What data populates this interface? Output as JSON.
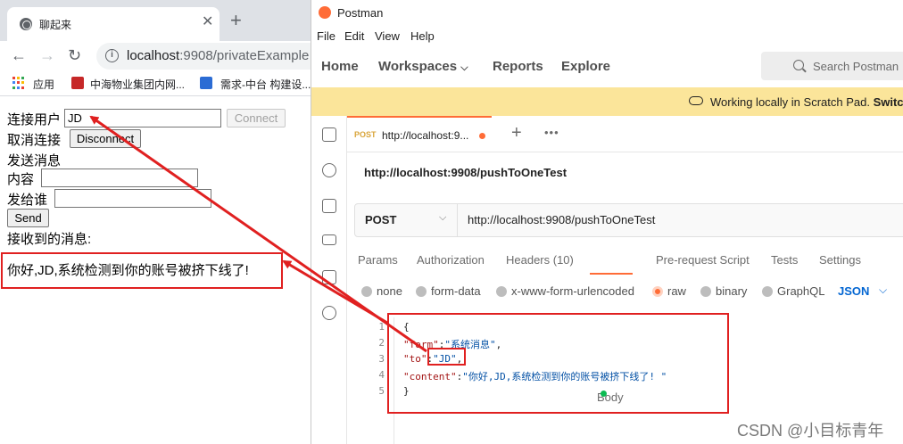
{
  "chrome": {
    "tab_title": "聊起来",
    "tab_close": "✕",
    "new_tab": "+",
    "url_host": "localhost",
    "url_rest": ":9908/privateExample",
    "bookmarks": [
      {
        "label": "应用"
      },
      {
        "label": "中海物业集团内网..."
      },
      {
        "label": "需求-中台 构建设..."
      }
    ],
    "page": {
      "connect_user_label": "连接用户",
      "connect_user_value": "JD",
      "connect_button": "Connect",
      "cancel_label": "取消连接",
      "disconnect_button": "Disconnect",
      "send_message_label": "发送消息",
      "content_label": "内容",
      "content_value": "",
      "send_to_label": "发给谁",
      "send_to_value": "",
      "send_button": "Send",
      "received_label": "接收到的消息:",
      "received_message": "你好,JD,系统检测到你的账号被挤下线了!"
    }
  },
  "postman": {
    "title": "Postman",
    "menu": [
      "File",
      "Edit",
      "View",
      "Help"
    ],
    "nav": {
      "home": "Home",
      "workspaces": "Workspaces",
      "reports": "Reports",
      "explore": "Explore",
      "search_placeholder": "Search Postman"
    },
    "banner": {
      "text": "Working locally in Scratch Pad.",
      "action": "Switch"
    },
    "request_tab": {
      "method": "POST",
      "url": "http://localhost:9..."
    },
    "request_name": "http://localhost:9908/pushToOneTest",
    "method": "POST",
    "url": "http://localhost:9908/pushToOneTest",
    "request_tabs": [
      "Params",
      "Authorization",
      "Headers (10)",
      "Body",
      "Pre-request Script",
      "Tests",
      "Settings"
    ],
    "body_types": [
      "none",
      "form-data",
      "x-www-form-urlencoded",
      "raw",
      "binary",
      "GraphQL"
    ],
    "body_format": "JSON",
    "code_lines": [
      {
        "n": "1",
        "text": "{"
      },
      {
        "n": "2",
        "key": "\"form\"",
        "value": "\"系统消息\"",
        "tail": ","
      },
      {
        "n": "3",
        "key": "\"to\"",
        "value": "\"JD\"",
        "tail": ","
      },
      {
        "n": "4",
        "key": "\"content\"",
        "value": "\"你好,JD,系统检测到你的账号被挤下线了! \"",
        "tail": ""
      },
      {
        "n": "5",
        "text": "}"
      }
    ]
  },
  "watermark": "CSDN @小目标青年",
  "colors": {
    "postman_orange": "#ff6c37",
    "annotation_red": "#e02020",
    "banner_yellow": "#fbe59a"
  }
}
